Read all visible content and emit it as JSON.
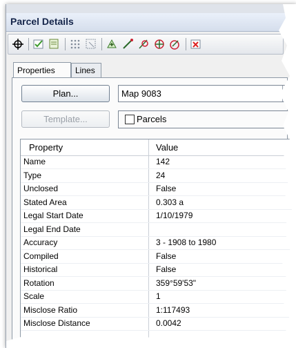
{
  "window": {
    "title": "Parcel Details"
  },
  "toolbar": {
    "buttons": [
      {
        "icon": "crosshair-icon"
      },
      {
        "icon": "check-parcel-icon"
      },
      {
        "icon": "edit-parcel-icon"
      },
      {
        "icon": "grid-points-icon"
      },
      {
        "icon": "select-box-icon"
      },
      {
        "icon": "add-point-icon"
      },
      {
        "icon": "draw-line-icon"
      },
      {
        "icon": "split-icon"
      },
      {
        "icon": "join-icon"
      },
      {
        "icon": "merge-icon"
      },
      {
        "icon": "delete-icon"
      }
    ]
  },
  "tabs": [
    {
      "label": "Properties",
      "active": true
    },
    {
      "label": "Lines",
      "active": false
    }
  ],
  "form": {
    "plan_button": "Plan...",
    "plan_value": "Map 9083",
    "template_button": "Template...",
    "layer_label": "Parcels"
  },
  "grid": {
    "headers": [
      "Property",
      "Value"
    ],
    "rows": [
      {
        "k": "Name",
        "v": "142"
      },
      {
        "k": "Type",
        "v": "24"
      },
      {
        "k": "Unclosed",
        "v": "False"
      },
      {
        "k": "Stated Area",
        "v": "0.303 a"
      },
      {
        "k": "Legal Start Date",
        "v": "1/10/1979"
      },
      {
        "k": "Legal End Date",
        "v": ""
      },
      {
        "k": "Accuracy",
        "v": "3 - 1908 to 1980"
      },
      {
        "k": "Compiled",
        "v": "False"
      },
      {
        "k": "Historical",
        "v": "False"
      },
      {
        "k": "Rotation",
        "v": "359°59'53\""
      },
      {
        "k": "Scale",
        "v": "1"
      },
      {
        "k": "Misclose Ratio",
        "v": "1:117493"
      },
      {
        "k": "Misclose Distance",
        "v": "0.0042"
      }
    ]
  }
}
